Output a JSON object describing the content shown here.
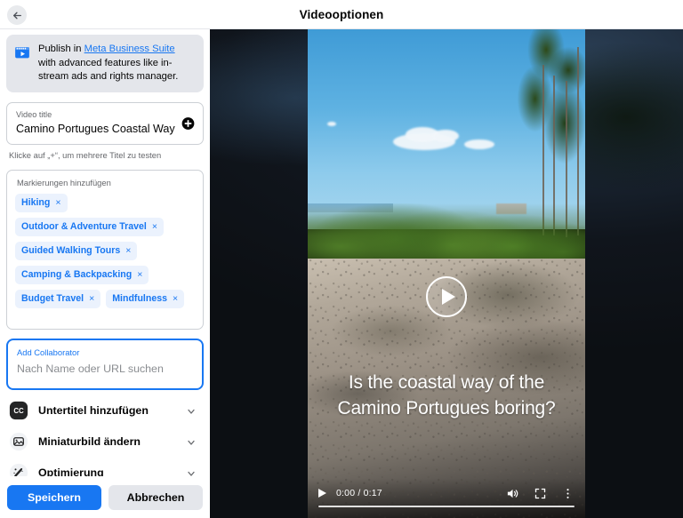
{
  "header": {
    "title": "Videooptionen",
    "back_icon": "arrow-left-icon"
  },
  "sidebar": {
    "banner": {
      "icon": "video-clapper-icon",
      "text_before": "Publish in ",
      "link_text": "Meta Business Suite",
      "text_after": " with advanced features like in-stream ads and rights manager."
    },
    "video_title_field": {
      "label": "Video title",
      "value": "Camino Portugues Coastal Way",
      "add_icon": "plus-circle-icon",
      "hint": "Klicke auf „+“, um mehrere Titel zu testen"
    },
    "tags": {
      "label": "Markierungen hinzufügen",
      "remove_glyph": "×",
      "items": [
        {
          "label": "Hiking"
        },
        {
          "label": "Outdoor & Adventure Travel"
        },
        {
          "label": "Guided Walking Tours"
        },
        {
          "label": "Camping & Backpacking"
        },
        {
          "label": "Budget Travel"
        },
        {
          "label": "Mindfulness"
        }
      ]
    },
    "collaborator": {
      "label": "Add Collaborator",
      "placeholder": "Nach Name oder URL suchen",
      "value": ""
    },
    "rows": [
      {
        "label": "Untertitel hinzufügen",
        "icon": "closed-caption-icon",
        "chevron": "chevron-down-icon"
      },
      {
        "label": "Miniaturbild ändern",
        "icon": "image-thumbnail-icon",
        "chevron": "chevron-down-icon"
      },
      {
        "label": "Optimierung",
        "icon": "magic-wand-icon",
        "chevron": "chevron-down-icon"
      }
    ],
    "footer": {
      "save_label": "Speichern",
      "cancel_label": "Abbrechen"
    }
  },
  "video": {
    "caption": "Is the coastal way of the Camino Portugues boring?",
    "play_overlay_icon": "play-circle-icon",
    "controls": {
      "play_icon": "play-icon",
      "time": "0:00 / 0:17",
      "current_time": "0:00",
      "duration": "0:17",
      "volume_icon": "volume-high-icon",
      "fullscreen_icon": "fullscreen-icon",
      "more_icon": "more-vertical-icon",
      "progress_percent": 0
    }
  },
  "colors": {
    "accent": "#1877f2",
    "chip_bg": "#ebf2fd",
    "banner_bg": "#e4e6eb",
    "secondary_button_bg": "#e4e6eb",
    "text_primary": "#050505",
    "text_secondary": "#65676b"
  }
}
